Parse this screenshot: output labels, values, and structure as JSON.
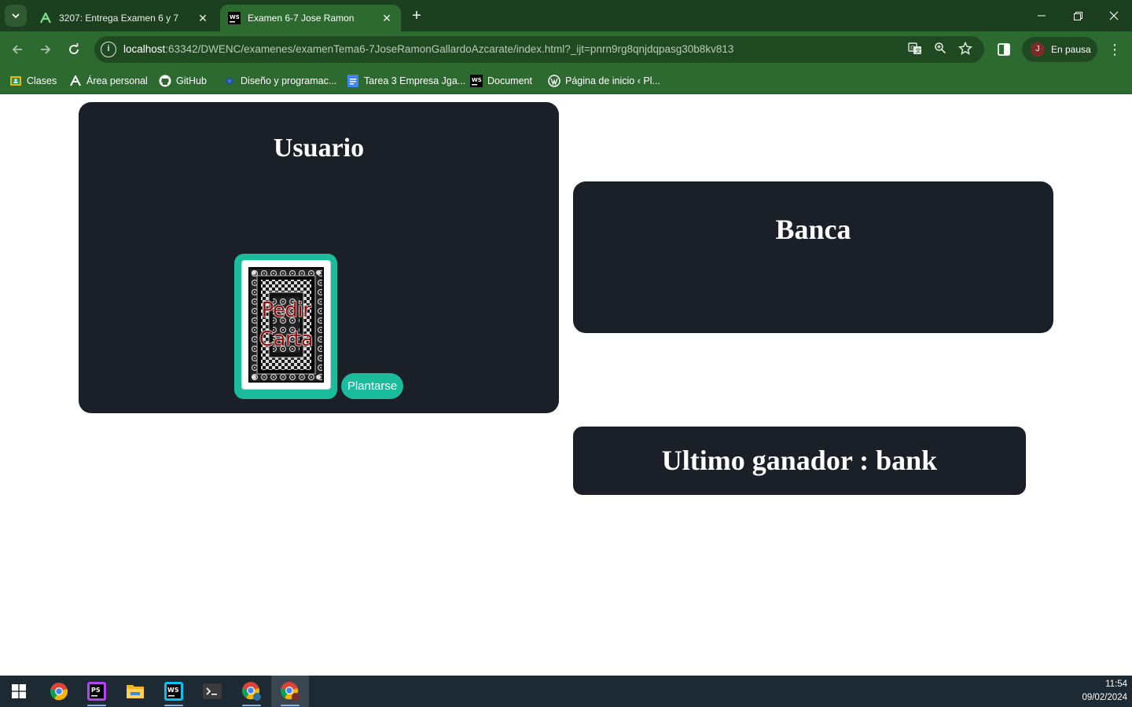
{
  "browser": {
    "tabs": [
      {
        "title": "3207: Entrega Examen 6 y 7",
        "favicon": "moodle-icon",
        "active": false
      },
      {
        "title": "Examen 6-7 Jose Ramon",
        "favicon": "webstorm-icon",
        "active": true
      }
    ],
    "url_host": "localhost",
    "url_rest": ":63342/DWENC/examenes/examenTema6-7JoseRamonGallardoAzcarate/index.html?_ijt=pnrn9rg8qnjdqpasg30b8kv813",
    "profile_initial": "J",
    "profile_label": "En pausa",
    "bookmarks": [
      {
        "label": "Clases",
        "icon": "classroom-icon"
      },
      {
        "label": "Área personal",
        "icon": "moodle-icon"
      },
      {
        "label": "GitHub",
        "icon": "github-icon"
      },
      {
        "label": "Diseño y programac...",
        "icon": "bookmark-icon"
      },
      {
        "label": "Tarea 3 Empresa Jga...",
        "icon": "docs-icon"
      },
      {
        "label": "Document",
        "icon": "webstorm-icon"
      },
      {
        "label": "Página de inicio ‹ Pl...",
        "icon": "wordpress-icon"
      }
    ]
  },
  "game": {
    "user_title": "Usuario",
    "card_line1": "Pedir",
    "card_line2": "Carta",
    "stand_label": "Plantarse",
    "bank_title": "Banca",
    "last_winner_label": "Ultimo ganador : bank"
  },
  "colors": {
    "panel_bg": "#1b1f28",
    "accent": "#1abc9c",
    "chrome_green": "#2d6a2f"
  },
  "taskbar": {
    "apps": [
      "windows-start-icon",
      "chrome-icon",
      "phpstorm-icon",
      "file-explorer-icon",
      "webstorm-icon",
      "terminal-icon",
      "chrome-profile-icon",
      "chrome-profile-j-icon"
    ],
    "time": "11:54",
    "date": "09/02/2024"
  }
}
